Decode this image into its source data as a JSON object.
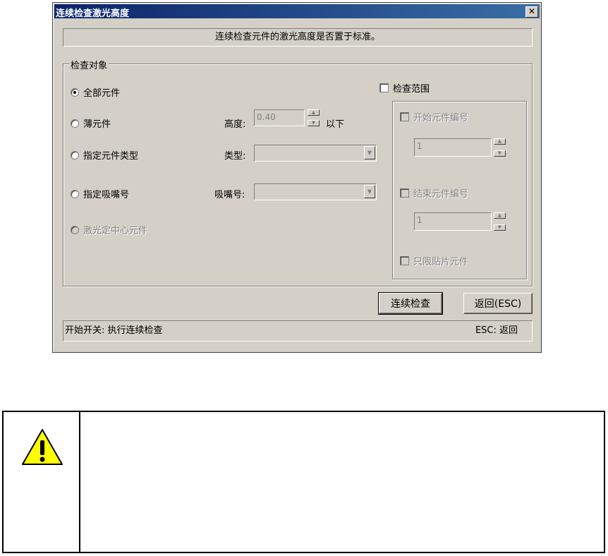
{
  "dialog": {
    "title": "连续检查激光高度",
    "close_label": "✕",
    "description": "连续检查元件的激光高度是否置于标准。",
    "group_label": "检查对象",
    "options": [
      {
        "label": "全部元件"
      },
      {
        "label": "薄元件"
      },
      {
        "label": "指定元件类型"
      },
      {
        "label": "指定吸嘴号"
      },
      {
        "label": "激光定中心元件"
      }
    ],
    "height": {
      "label": "高度:",
      "value": "0.40",
      "suffix": "以下"
    },
    "type": {
      "label": "类型:",
      "value": ""
    },
    "nozzle": {
      "label": "吸嘴号:",
      "value": ""
    },
    "range": {
      "label": "检查范围",
      "start_label": "开始元件编号",
      "start_value": "1",
      "end_label": "结束元件编号",
      "end_value": "1",
      "smd_label": "只限贴片元件"
    },
    "buttons": {
      "check": "连续检查",
      "back": "返回(ESC)"
    },
    "status": {
      "left": "开始开关: 执行连续检查",
      "right": "ESC: 返回"
    }
  }
}
